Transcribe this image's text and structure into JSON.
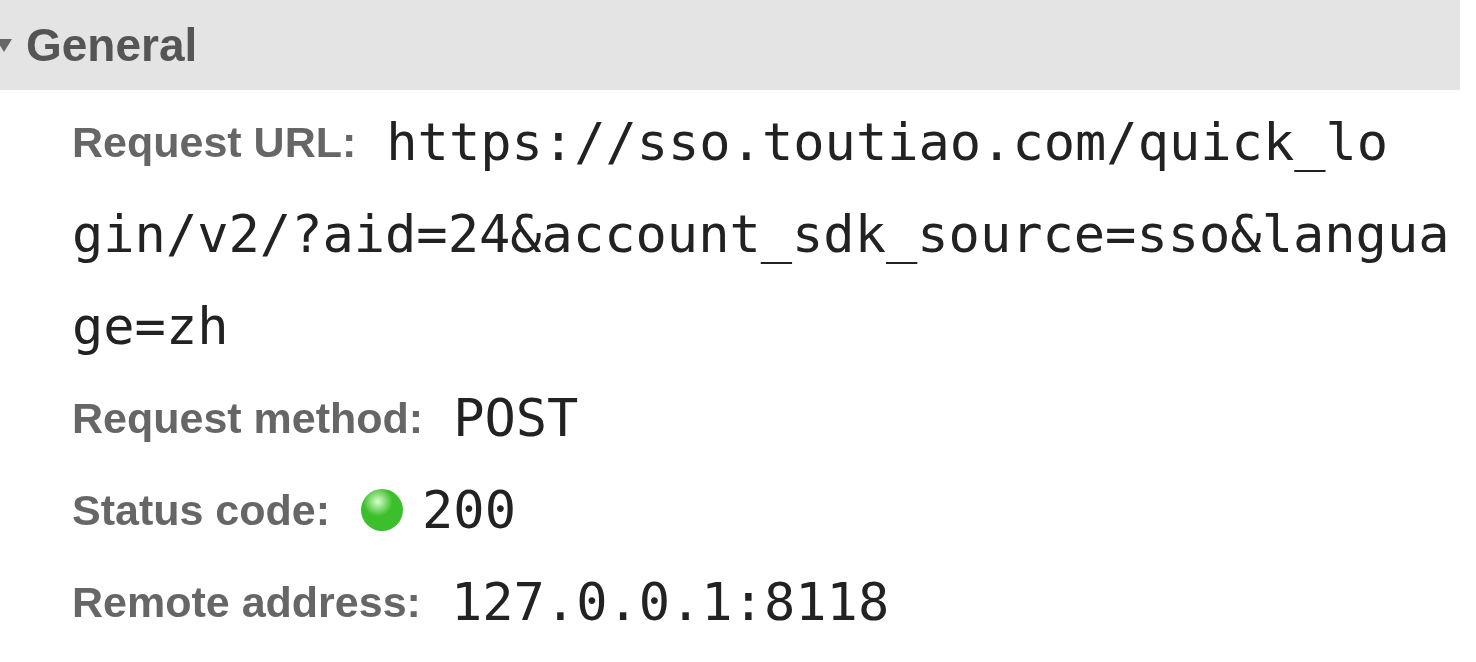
{
  "section": {
    "title": "General",
    "expanded": true
  },
  "rows": [
    {
      "label": "Request URL:",
      "value_lines": [
        "https://sso.toutiao.com/quick_lo",
        "gin/v2/?aid=24&account_sdk_source=sso&langua",
        "ge=zh"
      ]
    },
    {
      "label": "Request method:",
      "value_lines": [
        "POST"
      ]
    },
    {
      "label": "Status code:",
      "color": "#3cbf2c",
      "value_lines": [
        "200"
      ]
    },
    {
      "label": "Remote address:",
      "value_lines": [
        "127.0.0.1:8118"
      ]
    }
  ]
}
